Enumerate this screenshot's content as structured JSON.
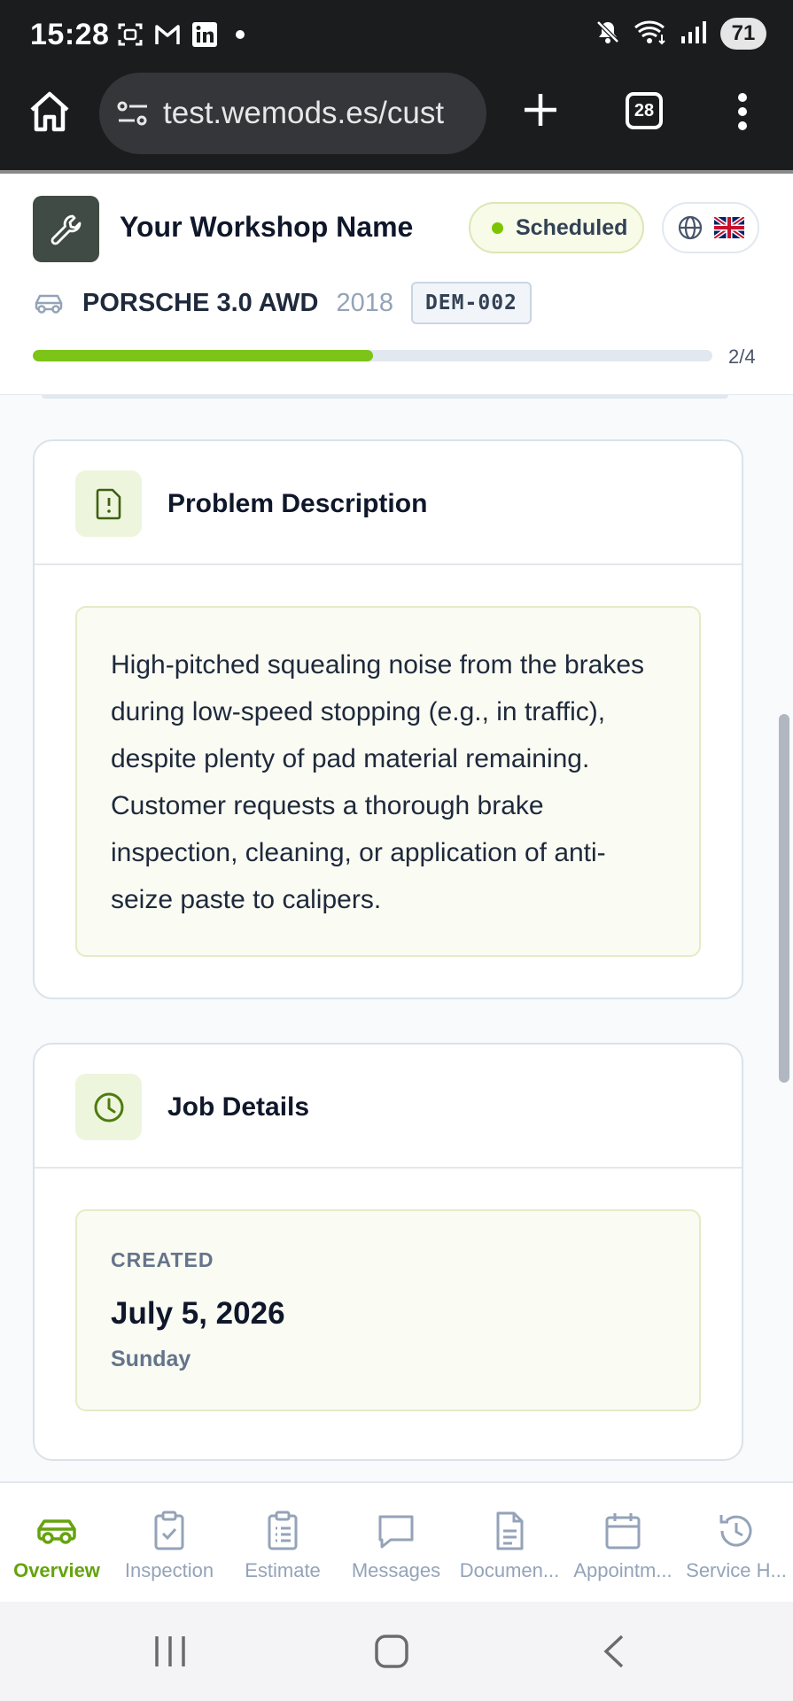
{
  "status_bar": {
    "time": "15:28",
    "battery": "71",
    "left_icons": [
      "screenshot-icon",
      "gmail-icon",
      "linkedin-icon",
      "dot-icon"
    ],
    "right_icons": [
      "mute-icon",
      "wifi-icon",
      "signal-icon"
    ]
  },
  "browser": {
    "url": "test.wemods.es/cust",
    "tab_count": "28"
  },
  "header": {
    "workshop_name": "Your Workshop Name",
    "status": "Scheduled",
    "vehicle": {
      "model": "PORSCHE 3.0 AWD",
      "year": "2018",
      "plate": "DEM-002"
    },
    "progress": {
      "label": "2/4",
      "fraction": 0.5
    }
  },
  "problem_card": {
    "title": "Problem Description",
    "text": "High-pitched squealing noise from the brakes during low-speed stopping (e.g., in traffic), despite plenty of pad material remaining. Customer requests a thorough brake inspection, cleaning, or application of anti-seize paste to calipers."
  },
  "job_card": {
    "title": "Job Details",
    "created_label": "CREATED",
    "created_date": "July 5, 2026",
    "created_day": "Sunday"
  },
  "bottom_nav": [
    {
      "label": "Overview",
      "icon": "car-icon",
      "active": true
    },
    {
      "label": "Inspection",
      "icon": "clipboard-check-icon",
      "active": false
    },
    {
      "label": "Estimate",
      "icon": "clipboard-list-icon",
      "active": false
    },
    {
      "label": "Messages",
      "icon": "message-icon",
      "active": false
    },
    {
      "label": "Documen...",
      "icon": "document-icon",
      "active": false
    },
    {
      "label": "Appointm...",
      "icon": "calendar-icon",
      "active": false
    },
    {
      "label": "Service H...",
      "icon": "history-icon",
      "active": false
    }
  ],
  "colors": {
    "accent": "#7cc417",
    "active_nav": "#65a30d",
    "logo_tile": "#3f4b44",
    "chrome_dark": "#1b1c1e"
  }
}
